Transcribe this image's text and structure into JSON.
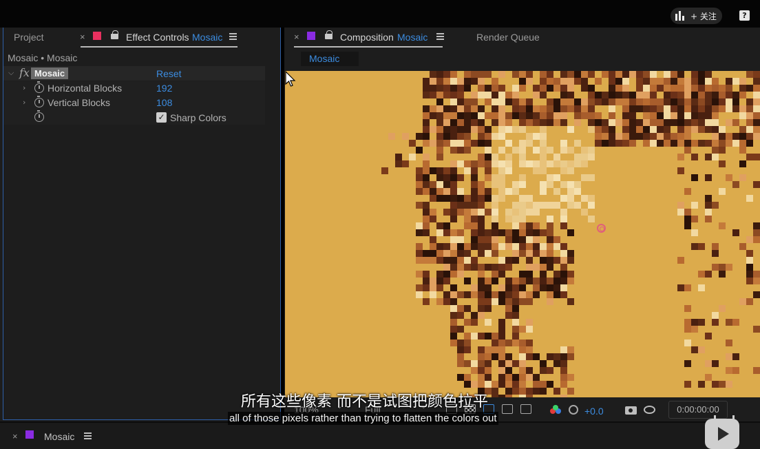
{
  "topbar": {
    "follow_label": "+ 关注",
    "help_label": "?"
  },
  "left_panel": {
    "project_tab": "Project",
    "effect_controls_tab": "Effect Controls",
    "effect_controls_layer": "Mosaic",
    "layer_path": "Mosaic • Mosaic",
    "effect": {
      "fx_label": "fx",
      "name": "Mosaic",
      "reset_label": "Reset",
      "properties": [
        {
          "name": "Horizontal Blocks",
          "value": "192"
        },
        {
          "name": "Vertical Blocks",
          "value": "108"
        }
      ],
      "sharp_colors_label": "Sharp Colors",
      "sharp_colors_checked": true
    }
  },
  "right_panel": {
    "composition_tab": "Composition",
    "composition_name": "Mosaic",
    "render_queue_tab": "Render Queue",
    "viewer_subtab": "Mosaic",
    "toolbar": {
      "zoom": "100%",
      "resolution": "Full",
      "exposure": "+0.0",
      "timecode": "0:00:00:00"
    }
  },
  "timeline": {
    "tab_label": "Mosaic"
  },
  "subtitles": {
    "zh": "所有这些像素 而不是试图把颜色拉平",
    "en": "all of those pixels rather than trying to flatten the colors out"
  },
  "colors": {
    "accent_blue": "#3c8ce0",
    "effect_controls_swatch": "#e8305f",
    "composition_swatch": "#8a2be2",
    "viewer_background": "#dcab4c"
  }
}
